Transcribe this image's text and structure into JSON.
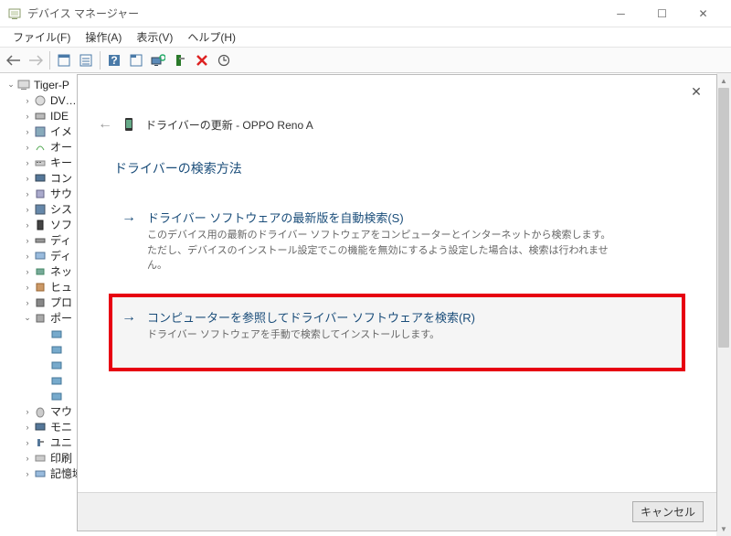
{
  "window": {
    "title": "デバイス マネージャー"
  },
  "menu": {
    "file": "ファイル(F)",
    "action": "操作(A)",
    "view": "表示(V)",
    "help": "ヘルプ(H)"
  },
  "tree": {
    "root": "Tiger-P",
    "items": [
      "DV…",
      "IDE",
      "イメ",
      "オー",
      "キー",
      "コン",
      "サウ",
      "シス",
      "ソフ",
      "ディ",
      "ディ",
      "ネッ",
      "ヒュ",
      "プロ",
      "ポー"
    ],
    "sub": [
      "",
      "",
      "",
      "",
      ""
    ],
    "after": [
      "マウ",
      "モニ",
      "ユニ",
      "印刷",
      "記憶域コントローラー"
    ]
  },
  "dialog": {
    "title": "ドライバーの更新 - OPPO Reno A",
    "heading": "ドライバーの検索方法",
    "option1": {
      "title": "ドライバー ソフトウェアの最新版を自動検索(S)",
      "desc": "このデバイス用の最新のドライバー ソフトウェアをコンピューターとインターネットから検索します。ただし、デバイスのインストール設定でこの機能を無効にするよう設定した場合は、検索は行われません。"
    },
    "option2": {
      "title": "コンピューターを参照してドライバー ソフトウェアを検索(R)",
      "desc": "ドライバー ソフトウェアを手動で検索してインストールします。"
    },
    "cancel": "キャンセル"
  }
}
